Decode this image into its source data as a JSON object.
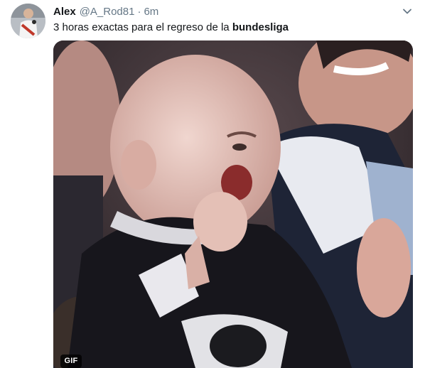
{
  "tweet": {
    "display_name": "Alex",
    "handle": "@A_Rod81",
    "separator": "·",
    "timestamp": "6m",
    "text_prefix": "3 horas exactas para el regreso de la ",
    "text_bold": "bundesliga",
    "media_badge": "GIF"
  },
  "icons": {
    "caret": "chevron-down-icon"
  },
  "colors": {
    "name": "#14171a",
    "secondary": "#657786",
    "badge_bg": "#000000"
  }
}
